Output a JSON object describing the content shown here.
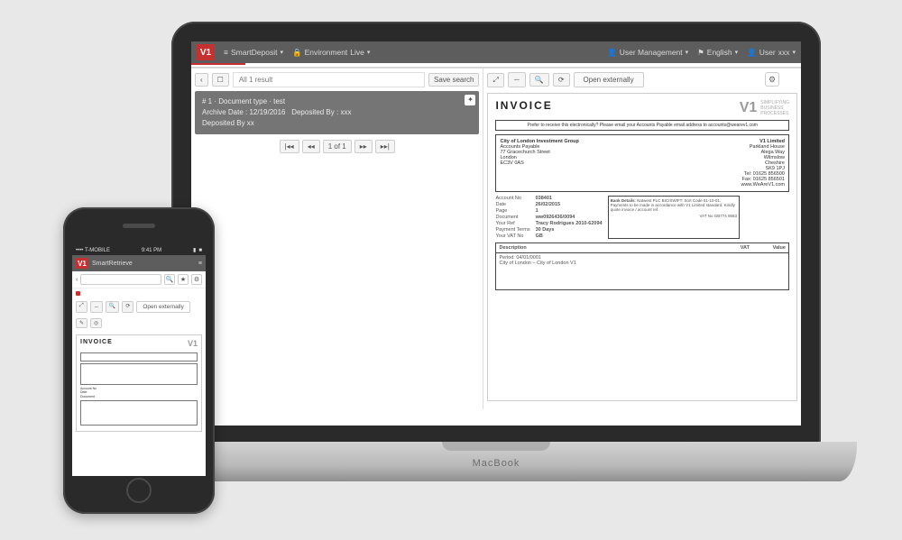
{
  "laptop_brand": "MacBook",
  "phone": {
    "status": {
      "carrier": "•••• T-MOBILE",
      "time": "9:41 PM",
      "battery": "■"
    },
    "app_title": "SmartRetrieve",
    "open_externally": "Open externally"
  },
  "header": {
    "app_menu": "SmartDeposit",
    "environment_label": "Environment",
    "environment_value": "Live",
    "user_mgmt": "User Management",
    "language": "English",
    "user_label": "User",
    "user_value": "xxx"
  },
  "search": {
    "result_count_label": "All 1 result",
    "save_search": "Save search",
    "pager": {
      "first": "|◂◂",
      "prev": "◂◂",
      "page": "1 of 1",
      "next": "▸▸",
      "last": "▸▸|"
    }
  },
  "document_card": {
    "line1": "# 1 · Document type · test",
    "archive_label": "Archive Date",
    "archive_value": "12/19/2016",
    "deposited_by_label": "Deposited By",
    "deposited_by_value": "xxx",
    "ref_by": "Deposited By xx"
  },
  "viewer": {
    "open_externally": "Open externally"
  },
  "invoice": {
    "title": "INVOICE",
    "logo_text": "V1",
    "logo_tag_l1": "SIMPLIFYING",
    "logo_tag_l2": "BUSINESS",
    "logo_tag_l3": "PROCESSES",
    "banner": "Prefer to receive this electronically? Please email your Accounts Payable email address to accounts@wearev1.com",
    "bill_to": {
      "name": "City of London Investment Group",
      "line1": "Accounts Payable",
      "line2": "77 Gracechurch Street",
      "city": "London",
      "postcode": "EC3V 0AS"
    },
    "from": {
      "name": "V1 Limited",
      "line1": "Parkland House",
      "line2": "Alega Way",
      "city": "Wilmslow",
      "county": "Cheshire",
      "postcode": "SK9 1PJ",
      "tel": "Tel: 01625 856500",
      "fax": "Fax: 01625 856501",
      "web": "www.WeAreV1.com"
    },
    "account_no_label": "Account No",
    "account_no": "038401",
    "date_label": "Date",
    "date": "26/02/2015",
    "page_label": "Page",
    "page": "1",
    "document_label": "Document",
    "document": "ww0926436/0094",
    "your_ref_label": "Your Ref",
    "your_ref": "Tracy Rodrigues 2010-62094",
    "payment_terms_label": "Payment Terms",
    "payment_terms": "30 Days",
    "vat_no_label": "Your VAT No",
    "vat_no": "GB",
    "company_vat_label": "VAT No",
    "company_vat": "GB774 9583",
    "bank_title": "Bank Details",
    "bank_body": "Natwest PLC BIC/SWIFT: Sort Code 01-10-01. Payments to be made in accordance with V1 Limited standard. Kindly quote invoice / account ref.",
    "columns": {
      "desc": "Description",
      "vat": "VAT",
      "value": "Value"
    },
    "line1_text": "Period: 04/01/0001",
    "line2_text": "City of London – City of London V1"
  }
}
